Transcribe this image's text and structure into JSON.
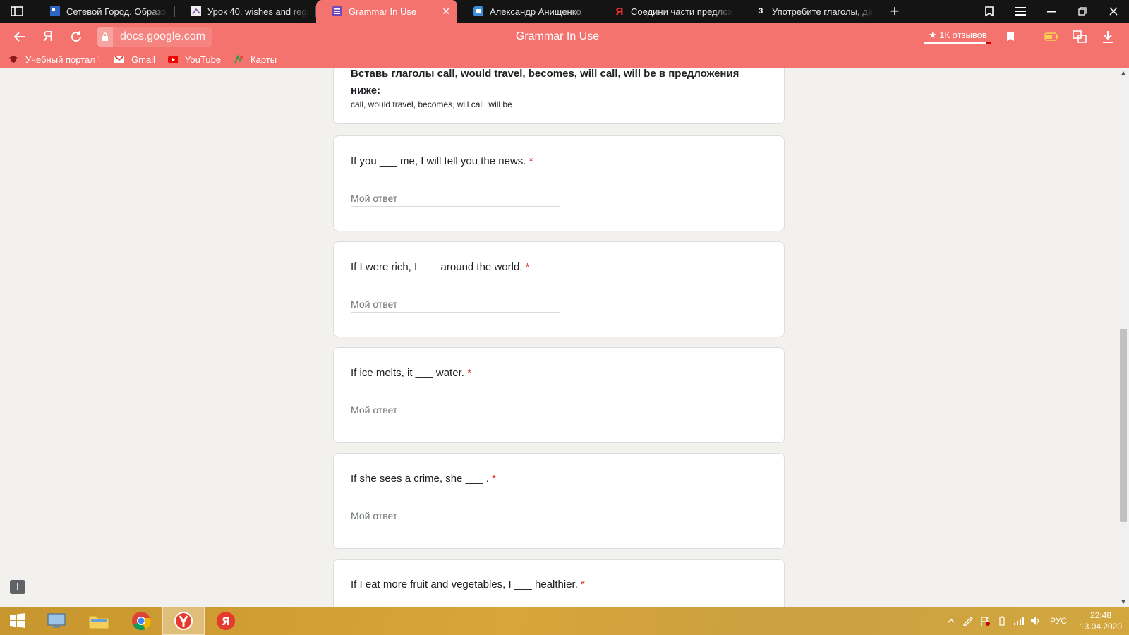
{
  "tabs": [
    {
      "title": "Сетевой Город. Образова",
      "active": false
    },
    {
      "title": "Урок 40. wishes and regret",
      "active": false
    },
    {
      "title": "Grammar In Use",
      "active": true
    },
    {
      "title": "Александр Анищенко",
      "active": false
    },
    {
      "title": "Соедини части предложе",
      "active": false
    },
    {
      "title": "Употребите глаголы, данн",
      "active": false
    }
  ],
  "address": {
    "url": "docs.google.com",
    "page_title": "Grammar In Use",
    "reviews": "★ 1К отзывов"
  },
  "bookmarks": [
    {
      "label": "Учебный портал V"
    },
    {
      "label": "Gmail"
    },
    {
      "label": "YouTube"
    },
    {
      "label": "Карты"
    }
  ],
  "form": {
    "intro_heading": "Вставь глаголы call, would travel, becomes, will call, will be в предложения ниже:",
    "intro_sub": "call, would travel, becomes, will call, will be",
    "placeholder": "Мой ответ",
    "required_mark": "*",
    "questions": [
      "If you ___ me, I will tell you the news.",
      "If I were rich, I ___ around the world.",
      "If ice melts, it ___ water.",
      "If she sees a crime, she ___ .",
      "If I eat more fruit and vegetables, I ___ healthier."
    ]
  },
  "feedback_icon": "!",
  "tray": {
    "lang": "РУС",
    "time": "22:48",
    "date": "13.04.2020"
  },
  "colors": {
    "accent": "#f4736f",
    "tabbar": "#141414",
    "required": "#d93025"
  }
}
